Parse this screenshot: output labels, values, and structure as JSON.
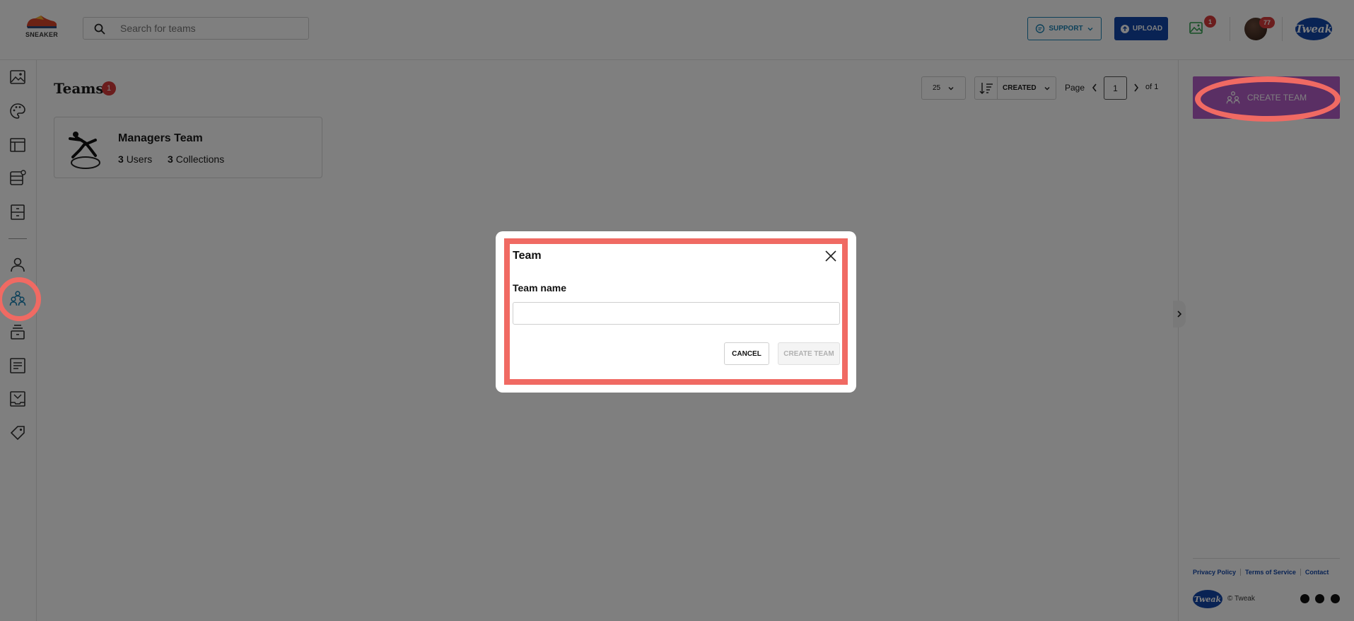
{
  "header": {
    "logo_text": "SNEAKER",
    "search_placeholder": "Search for teams",
    "support_label": "SUPPORT",
    "upload_label": "UPLOAD",
    "gallery_badge": "1",
    "avatar_badge": "77",
    "brand_logo_text": "Tweak"
  },
  "main": {
    "title": "Teams",
    "title_badge": "1",
    "per_page": "25",
    "sort_label": "CREATED",
    "page_label": "Page",
    "page_current": "1",
    "page_total": "of 1",
    "teams": [
      {
        "name": "Managers Team",
        "users_count": "3",
        "users_label": "Users",
        "collections_count": "3",
        "collections_label": "Collections"
      }
    ]
  },
  "right_panel": {
    "create_team_label": "CREATE TEAM",
    "footer_links": [
      "Privacy Policy",
      "Terms of Service",
      "Contact"
    ],
    "footer_logo_text": "Tweak",
    "copyright": "© Tweak"
  },
  "modal": {
    "title": "Team",
    "field_label": "Team name",
    "field_value": "",
    "cancel_label": "CANCEL",
    "create_label": "CREATE TEAM"
  },
  "colors": {
    "accent_blue": "#1347a8",
    "support_blue": "#1b83b5",
    "badge_red": "#d63a3a",
    "create_purple": "#b55ec8",
    "annotation_red": "#f06a63"
  }
}
